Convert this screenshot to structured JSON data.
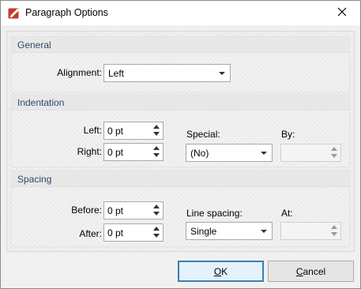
{
  "window": {
    "title": "Paragraph Options",
    "app_icon": "pdf-editor-icon",
    "close_icon": "close-icon"
  },
  "general": {
    "title": "General",
    "alignment_label": "Alignment:",
    "alignment_value": "Left"
  },
  "indentation": {
    "title": "Indentation",
    "left_label": "Left:",
    "left_value": "0 pt",
    "right_label": "Right:",
    "right_value": "0 pt",
    "special_label": "Special:",
    "special_value": "(No)",
    "by_label": "By:",
    "by_value": ""
  },
  "spacing": {
    "title": "Spacing",
    "before_label": "Before:",
    "before_value": "0 pt",
    "after_label": "After:",
    "after_value": "0 pt",
    "line_spacing_label": "Line spacing:",
    "line_spacing_value": "Single",
    "at_label": "At:",
    "at_value": ""
  },
  "buttons": {
    "ok_mnemonic": "O",
    "ok_rest": "K",
    "cancel_mnemonic": "C",
    "cancel_rest": "ancel"
  },
  "colors": {
    "section_title": "#2b4a6e",
    "default_button_border": "#3c7fb1"
  }
}
